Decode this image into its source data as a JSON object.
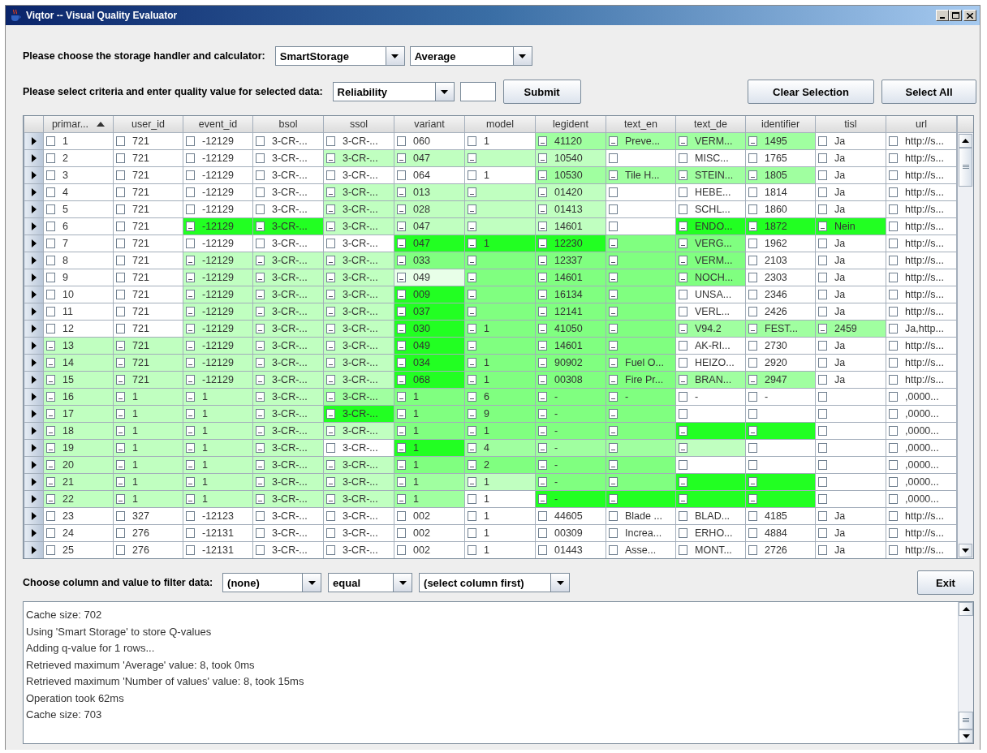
{
  "window": {
    "title": "Viqtor -- Visual Quality Evaluator"
  },
  "storage_row": {
    "label": "Please choose the storage handler and calculator:",
    "handler": "SmartStorage",
    "calculator": "Average"
  },
  "criteria_row": {
    "label": "Please select criteria and enter quality value for selected data:",
    "criteria": "Reliability",
    "submit": "Submit",
    "clear": "Clear Selection",
    "select_all": "Select All"
  },
  "table": {
    "columns": [
      {
        "label": "primar...",
        "sorted": true
      },
      {
        "label": "user_id",
        "sorted": false
      },
      {
        "label": "event_id",
        "sorted": false
      },
      {
        "label": "bsol",
        "sorted": false
      },
      {
        "label": "ssol",
        "sorted": false
      },
      {
        "label": "variant",
        "sorted": false
      },
      {
        "label": "model",
        "sorted": false
      },
      {
        "label": "legident",
        "sorted": false
      },
      {
        "label": "text_en",
        "sorted": false
      },
      {
        "label": "text_de",
        "sorted": false
      },
      {
        "label": "identifier",
        "sorted": false
      },
      {
        "label": "tisl",
        "sorted": false
      },
      {
        "label": "url",
        "sorted": false
      }
    ],
    "rows": [
      {
        "cells": [
          {
            "text": "1",
            "color": "#ffffff"
          },
          {
            "text": "721",
            "color": "#ffffff"
          },
          {
            "text": "-12129",
            "color": "#ffffff"
          },
          {
            "text": "3-CR-...",
            "color": "#ffffff"
          },
          {
            "text": "3-CR-...",
            "color": "#ffffff"
          },
          {
            "text": "060",
            "color": "#ffffff"
          },
          {
            "text": "1",
            "color": "#ffffff"
          },
          {
            "text": "41120",
            "color": "#a0ffa0"
          },
          {
            "text": "Preve...",
            "color": "#a0ffa0"
          },
          {
            "text": "VERM...",
            "color": "#a0ffa0"
          },
          {
            "text": "1495",
            "color": "#a0ffa0"
          },
          {
            "text": "Ja",
            "color": "#ffffff"
          },
          {
            "text": "http://s...",
            "color": "#ffffff"
          }
        ]
      },
      {
        "cells": [
          {
            "text": "2",
            "color": "#ffffff"
          },
          {
            "text": "721",
            "color": "#ffffff"
          },
          {
            "text": "-12129",
            "color": "#ffffff"
          },
          {
            "text": "3-CR-...",
            "color": "#ffffff"
          },
          {
            "text": "3-CR-...",
            "color": "#c0ffc0"
          },
          {
            "text": "047",
            "color": "#c0ffc0"
          },
          {
            "color": "#c0ffc0"
          },
          {
            "text": "10540",
            "color": "#c0ffc0"
          },
          {
            "color": "#ffffff"
          },
          {
            "text": "MISC...",
            "color": "#ffffff"
          },
          {
            "text": "1765",
            "color": "#ffffff"
          },
          {
            "text": "Ja",
            "color": "#ffffff"
          },
          {
            "text": "http://s...",
            "color": "#ffffff"
          }
        ]
      },
      {
        "cells": [
          {
            "text": "3",
            "color": "#ffffff"
          },
          {
            "text": "721",
            "color": "#ffffff"
          },
          {
            "text": "-12129",
            "color": "#ffffff"
          },
          {
            "text": "3-CR-...",
            "color": "#ffffff"
          },
          {
            "text": "3-CR-...",
            "color": "#ffffff"
          },
          {
            "text": "064",
            "color": "#ffffff"
          },
          {
            "text": "1",
            "color": "#ffffff"
          },
          {
            "text": "10530",
            "color": "#a0ffa0"
          },
          {
            "text": "Tile H...",
            "color": "#a0ffa0"
          },
          {
            "text": "STEIN...",
            "color": "#a0ffa0"
          },
          {
            "text": "1805",
            "color": "#a0ffa0"
          },
          {
            "text": "Ja",
            "color": "#ffffff"
          },
          {
            "text": "http://s...",
            "color": "#ffffff"
          }
        ]
      },
      {
        "cells": [
          {
            "text": "4",
            "color": "#ffffff"
          },
          {
            "text": "721",
            "color": "#ffffff"
          },
          {
            "text": "-12129",
            "color": "#ffffff"
          },
          {
            "text": "3-CR-...",
            "color": "#ffffff"
          },
          {
            "text": "3-CR-...",
            "color": "#c0ffc0"
          },
          {
            "text": "013",
            "color": "#c0ffc0"
          },
          {
            "color": "#c0ffc0"
          },
          {
            "text": "01420",
            "color": "#c0ffc0"
          },
          {
            "color": "#ffffff"
          },
          {
            "text": "HEBE...",
            "color": "#ffffff"
          },
          {
            "text": "1814",
            "color": "#ffffff"
          },
          {
            "text": "Ja",
            "color": "#ffffff"
          },
          {
            "text": "http://s...",
            "color": "#ffffff"
          }
        ]
      },
      {
        "cells": [
          {
            "text": "5",
            "color": "#ffffff"
          },
          {
            "text": "721",
            "color": "#ffffff"
          },
          {
            "text": "-12129",
            "color": "#ffffff"
          },
          {
            "text": "3-CR-...",
            "color": "#ffffff"
          },
          {
            "text": "3-CR-...",
            "color": "#c0ffc0"
          },
          {
            "text": "028",
            "color": "#c0ffc0"
          },
          {
            "color": "#c0ffc0"
          },
          {
            "text": "01413",
            "color": "#c0ffc0"
          },
          {
            "color": "#ffffff"
          },
          {
            "text": "SCHL...",
            "color": "#ffffff"
          },
          {
            "text": "1860",
            "color": "#ffffff"
          },
          {
            "text": "Ja",
            "color": "#ffffff"
          },
          {
            "text": "http://s...",
            "color": "#ffffff"
          }
        ]
      },
      {
        "cells": [
          {
            "text": "6",
            "color": "#ffffff"
          },
          {
            "text": "721",
            "color": "#ffffff"
          },
          {
            "text": "-12129",
            "color": "#22ff22"
          },
          {
            "text": "3-CR-...",
            "color": "#22ff22"
          },
          {
            "text": "3-CR-...",
            "color": "#c0ffc0"
          },
          {
            "text": "047",
            "color": "#c0ffc0"
          },
          {
            "color": "#c0ffc0"
          },
          {
            "text": "14601",
            "color": "#c0ffc0"
          },
          {
            "color": "#ffffff"
          },
          {
            "text": "ENDO...",
            "color": "#22ff22"
          },
          {
            "text": "1872",
            "color": "#22ff22"
          },
          {
            "text": "Nein",
            "color": "#22ff22"
          },
          {
            "text": "http://s...",
            "color": "#ffffff"
          }
        ]
      },
      {
        "cells": [
          {
            "text": "7",
            "color": "#ffffff"
          },
          {
            "text": "721",
            "color": "#ffffff"
          },
          {
            "text": "-12129",
            "color": "#ffffff"
          },
          {
            "text": "3-CR-...",
            "color": "#ffffff"
          },
          {
            "text": "3-CR-...",
            "color": "#ffffff"
          },
          {
            "text": "047",
            "color": "#22ff22"
          },
          {
            "text": "1",
            "color": "#22ff22"
          },
          {
            "text": "12230",
            "color": "#22ff22"
          },
          {
            "color": "#80ff80"
          },
          {
            "text": "VERG...",
            "color": "#80ff80"
          },
          {
            "text": "1962",
            "color": "#ffffff"
          },
          {
            "text": "Ja",
            "color": "#ffffff"
          },
          {
            "text": "http://s...",
            "color": "#ffffff"
          }
        ]
      },
      {
        "cells": [
          {
            "text": "8",
            "color": "#ffffff"
          },
          {
            "text": "721",
            "color": "#ffffff"
          },
          {
            "text": "-12129",
            "color": "#c0ffc0"
          },
          {
            "text": "3-CR-...",
            "color": "#c0ffc0"
          },
          {
            "text": "3-CR-...",
            "color": "#c0ffc0"
          },
          {
            "text": "033",
            "color": "#80ff80"
          },
          {
            "color": "#80ff80"
          },
          {
            "text": "12337",
            "color": "#80ff80"
          },
          {
            "color": "#80ff80"
          },
          {
            "text": "VERM...",
            "color": "#80ff80"
          },
          {
            "text": "2103",
            "color": "#ffffff"
          },
          {
            "text": "Ja",
            "color": "#ffffff"
          },
          {
            "text": "http://s...",
            "color": "#ffffff"
          }
        ]
      },
      {
        "cells": [
          {
            "text": "9",
            "color": "#ffffff"
          },
          {
            "text": "721",
            "color": "#ffffff"
          },
          {
            "text": "-12129",
            "color": "#c0ffc0"
          },
          {
            "text": "3-CR-...",
            "color": "#c0ffc0"
          },
          {
            "text": "3-CR-...",
            "color": "#c0ffc0"
          },
          {
            "text": "049",
            "color": "#e8ffe8"
          },
          {
            "color": "#80ff80"
          },
          {
            "text": "14601",
            "color": "#80ff80"
          },
          {
            "color": "#80ff80"
          },
          {
            "text": "NOCH...",
            "color": "#80ff80"
          },
          {
            "text": "2303",
            "color": "#ffffff"
          },
          {
            "text": "Ja",
            "color": "#ffffff"
          },
          {
            "text": "http://s...",
            "color": "#ffffff"
          }
        ]
      },
      {
        "cells": [
          {
            "text": "10",
            "color": "#ffffff"
          },
          {
            "text": "721",
            "color": "#ffffff"
          },
          {
            "text": "-12129",
            "color": "#c0ffc0"
          },
          {
            "text": "3-CR-...",
            "color": "#c0ffc0"
          },
          {
            "text": "3-CR-...",
            "color": "#c0ffc0"
          },
          {
            "text": "009",
            "color": "#22ff22"
          },
          {
            "color": "#80ff80"
          },
          {
            "text": "16134",
            "color": "#80ff80"
          },
          {
            "color": "#80ff80"
          },
          {
            "text": "UNSA...",
            "color": "#ffffff"
          },
          {
            "text": "2346",
            "color": "#ffffff"
          },
          {
            "text": "Ja",
            "color": "#ffffff"
          },
          {
            "text": "http://s...",
            "color": "#ffffff"
          }
        ]
      },
      {
        "cells": [
          {
            "text": "11",
            "color": "#ffffff"
          },
          {
            "text": "721",
            "color": "#ffffff"
          },
          {
            "text": "-12129",
            "color": "#c0ffc0"
          },
          {
            "text": "3-CR-...",
            "color": "#c0ffc0"
          },
          {
            "text": "3-CR-...",
            "color": "#c0ffc0"
          },
          {
            "text": "037",
            "color": "#22ff22"
          },
          {
            "color": "#80ff80"
          },
          {
            "text": "12141",
            "color": "#80ff80"
          },
          {
            "color": "#80ff80"
          },
          {
            "text": "VERL...",
            "color": "#ffffff"
          },
          {
            "text": "2426",
            "color": "#ffffff"
          },
          {
            "text": "Ja",
            "color": "#ffffff"
          },
          {
            "text": "http://s...",
            "color": "#ffffff"
          }
        ]
      },
      {
        "cells": [
          {
            "text": "12",
            "color": "#ffffff"
          },
          {
            "text": "721",
            "color": "#ffffff"
          },
          {
            "text": "-12129",
            "color": "#c0ffc0"
          },
          {
            "text": "3-CR-...",
            "color": "#c0ffc0"
          },
          {
            "text": "3-CR-...",
            "color": "#c0ffc0"
          },
          {
            "text": "030",
            "color": "#22ff22"
          },
          {
            "text": "1",
            "color": "#80ff80"
          },
          {
            "text": "41050",
            "color": "#80ff80"
          },
          {
            "color": "#80ff80"
          },
          {
            "text": "V94.2",
            "color": "#a0ffa0"
          },
          {
            "text": "FEST...",
            "color": "#a0ffa0"
          },
          {
            "text": "2459",
            "color": "#a0ffa0"
          },
          {
            "text": "Ja,http...",
            "color": "#ffffff"
          }
        ]
      },
      {
        "cells": [
          {
            "text": "13",
            "color": "#c0ffc0"
          },
          {
            "text": "721",
            "color": "#c0ffc0"
          },
          {
            "text": "-12129",
            "color": "#c0ffc0"
          },
          {
            "text": "3-CR-...",
            "color": "#c0ffc0"
          },
          {
            "text": "3-CR-...",
            "color": "#c0ffc0"
          },
          {
            "text": "049",
            "color": "#22ff22"
          },
          {
            "color": "#80ff80"
          },
          {
            "text": "14601",
            "color": "#80ff80"
          },
          {
            "color": "#80ff80"
          },
          {
            "text": "AK-RI...",
            "color": "#ffffff"
          },
          {
            "text": "2730",
            "color": "#ffffff"
          },
          {
            "text": "Ja",
            "color": "#ffffff"
          },
          {
            "text": "http://s...",
            "color": "#ffffff"
          }
        ]
      },
      {
        "cells": [
          {
            "text": "14",
            "color": "#c0ffc0"
          },
          {
            "text": "721",
            "color": "#c0ffc0"
          },
          {
            "text": "-12129",
            "color": "#c0ffc0"
          },
          {
            "text": "3-CR-...",
            "color": "#c0ffc0"
          },
          {
            "text": "3-CR-...",
            "color": "#c0ffc0"
          },
          {
            "text": "034",
            "color": "#22ff22"
          },
          {
            "text": "1",
            "color": "#80ff80"
          },
          {
            "text": "90902",
            "color": "#80ff80"
          },
          {
            "text": "Fuel O...",
            "color": "#80ff80"
          },
          {
            "text": "HEIZO...",
            "color": "#ffffff"
          },
          {
            "text": "2920",
            "color": "#ffffff"
          },
          {
            "text": "Ja",
            "color": "#ffffff"
          },
          {
            "text": "http://s...",
            "color": "#ffffff"
          }
        ]
      },
      {
        "cells": [
          {
            "text": "15",
            "color": "#c0ffc0"
          },
          {
            "text": "721",
            "color": "#c0ffc0"
          },
          {
            "text": "-12129",
            "color": "#c0ffc0"
          },
          {
            "text": "3-CR-...",
            "color": "#c0ffc0"
          },
          {
            "text": "3-CR-...",
            "color": "#c0ffc0"
          },
          {
            "text": "068",
            "color": "#22ff22"
          },
          {
            "text": "1",
            "color": "#80ff80"
          },
          {
            "text": "00308",
            "color": "#80ff80"
          },
          {
            "text": "Fire Pr...",
            "color": "#80ff80"
          },
          {
            "text": "BRAN...",
            "color": "#a0ffa0"
          },
          {
            "text": "2947",
            "color": "#a0ffa0"
          },
          {
            "text": "Ja",
            "color": "#ffffff"
          },
          {
            "text": "http://s...",
            "color": "#ffffff"
          }
        ]
      },
      {
        "cells": [
          {
            "text": "16",
            "color": "#c0ffc0"
          },
          {
            "text": "1",
            "color": "#c0ffc0"
          },
          {
            "text": "1",
            "color": "#c0ffc0"
          },
          {
            "text": "3-CR-...",
            "color": "#c0ffc0"
          },
          {
            "text": "3-CR-...",
            "color": "#a0ffa0"
          },
          {
            "text": "1",
            "color": "#80ff80"
          },
          {
            "text": "6",
            "color": "#80ff80"
          },
          {
            "text": "-",
            "color": "#80ff80"
          },
          {
            "text": "-",
            "color": "#80ff80"
          },
          {
            "text": "-",
            "color": "#ffffff"
          },
          {
            "text": "-",
            "color": "#ffffff"
          },
          {
            "color": "#ffffff"
          },
          {
            "text": ",0000...",
            "color": "#ffffff"
          }
        ]
      },
      {
        "cells": [
          {
            "text": "17",
            "color": "#c0ffc0"
          },
          {
            "text": "1",
            "color": "#c0ffc0"
          },
          {
            "text": "1",
            "color": "#c0ffc0"
          },
          {
            "text": "3-CR-...",
            "color": "#c0ffc0"
          },
          {
            "text": "3-CR-...",
            "color": "#22ff22"
          },
          {
            "text": "1",
            "color": "#80ff80"
          },
          {
            "text": "9",
            "color": "#80ff80"
          },
          {
            "text": "-",
            "color": "#80ff80"
          },
          {
            "color": "#80ff80"
          },
          {
            "color": "#ffffff"
          },
          {
            "color": "#ffffff"
          },
          {
            "color": "#ffffff"
          },
          {
            "text": ",0000...",
            "color": "#ffffff"
          }
        ]
      },
      {
        "cells": [
          {
            "text": "18",
            "color": "#c0ffc0"
          },
          {
            "text": "1",
            "color": "#c0ffc0"
          },
          {
            "text": "1",
            "color": "#c0ffc0"
          },
          {
            "text": "3-CR-...",
            "color": "#c0ffc0"
          },
          {
            "text": "3-CR-...",
            "color": "#c0ffc0"
          },
          {
            "text": "1",
            "color": "#80ff80"
          },
          {
            "text": "1",
            "color": "#80ff80"
          },
          {
            "text": "-",
            "color": "#80ff80"
          },
          {
            "color": "#80ff80"
          },
          {
            "color": "#22ff22"
          },
          {
            "color": "#22ff22"
          },
          {
            "color": "#ffffff"
          },
          {
            "text": ",0000...",
            "color": "#ffffff"
          }
        ]
      },
      {
        "cells": [
          {
            "text": "19",
            "color": "#c0ffc0"
          },
          {
            "text": "1",
            "color": "#c0ffc0"
          },
          {
            "text": "1",
            "color": "#c0ffc0"
          },
          {
            "text": "3-CR-...",
            "color": "#c0ffc0"
          },
          {
            "text": "3-CR-...",
            "color": "#ffffff"
          },
          {
            "text": "1",
            "color": "#22ff22"
          },
          {
            "text": "4",
            "color": "#a0ffa0"
          },
          {
            "text": "-",
            "color": "#a0ffa0"
          },
          {
            "color": "#a0ffa0"
          },
          {
            "color": "#c0ffc0"
          },
          {
            "color": "#ffffff"
          },
          {
            "color": "#ffffff"
          },
          {
            "text": ",0000...",
            "color": "#ffffff"
          }
        ]
      },
      {
        "cells": [
          {
            "text": "20",
            "color": "#c0ffc0"
          },
          {
            "text": "1",
            "color": "#c0ffc0"
          },
          {
            "text": "1",
            "color": "#c0ffc0"
          },
          {
            "text": "3-CR-...",
            "color": "#c0ffc0"
          },
          {
            "text": "3-CR-...",
            "color": "#c0ffc0"
          },
          {
            "text": "1",
            "color": "#80ff80"
          },
          {
            "text": "2",
            "color": "#80ff80"
          },
          {
            "text": "-",
            "color": "#80ff80"
          },
          {
            "color": "#80ff80"
          },
          {
            "color": "#ffffff"
          },
          {
            "color": "#ffffff"
          },
          {
            "color": "#ffffff"
          },
          {
            "text": ",0000...",
            "color": "#ffffff"
          }
        ]
      },
      {
        "cells": [
          {
            "text": "21",
            "color": "#c0ffc0"
          },
          {
            "text": "1",
            "color": "#c0ffc0"
          },
          {
            "text": "1",
            "color": "#c0ffc0"
          },
          {
            "text": "3-CR-...",
            "color": "#c0ffc0"
          },
          {
            "text": "3-CR-...",
            "color": "#c0ffc0"
          },
          {
            "text": "1",
            "color": "#a0ffa0"
          },
          {
            "text": "1",
            "color": "#c0ffc0"
          },
          {
            "text": "-",
            "color": "#80ff80"
          },
          {
            "color": "#80ff80"
          },
          {
            "color": "#22ff22"
          },
          {
            "color": "#22ff22"
          },
          {
            "color": "#ffffff"
          },
          {
            "text": ",0000...",
            "color": "#ffffff"
          }
        ]
      },
      {
        "cells": [
          {
            "text": "22",
            "color": "#c0ffc0"
          },
          {
            "text": "1",
            "color": "#c0ffc0"
          },
          {
            "text": "1",
            "color": "#c0ffc0"
          },
          {
            "text": "3-CR-...",
            "color": "#c0ffc0"
          },
          {
            "text": "3-CR-...",
            "color": "#c0ffc0"
          },
          {
            "text": "1",
            "color": "#a0ffa0"
          },
          {
            "text": "1",
            "color": "#ffffff"
          },
          {
            "text": "-",
            "color": "#22ff22"
          },
          {
            "color": "#22ff22"
          },
          {
            "color": "#22ff22"
          },
          {
            "color": "#22ff22"
          },
          {
            "color": "#ffffff"
          },
          {
            "text": ",0000...",
            "color": "#ffffff"
          }
        ]
      },
      {
        "cells": [
          {
            "text": "23",
            "color": "#ffffff"
          },
          {
            "text": "327",
            "color": "#ffffff"
          },
          {
            "text": "-12123",
            "color": "#ffffff"
          },
          {
            "text": "3-CR-...",
            "color": "#ffffff"
          },
          {
            "text": "3-CR-...",
            "color": "#ffffff"
          },
          {
            "text": "002",
            "color": "#ffffff"
          },
          {
            "text": "1",
            "color": "#ffffff"
          },
          {
            "text": "44605",
            "color": "#ffffff"
          },
          {
            "text": "Blade ...",
            "color": "#ffffff"
          },
          {
            "text": "BLAD...",
            "color": "#ffffff"
          },
          {
            "text": "4185",
            "color": "#ffffff"
          },
          {
            "text": "Ja",
            "color": "#ffffff"
          },
          {
            "text": "http://s...",
            "color": "#ffffff"
          }
        ]
      },
      {
        "cells": [
          {
            "text": "24",
            "color": "#ffffff"
          },
          {
            "text": "276",
            "color": "#ffffff"
          },
          {
            "text": "-12131",
            "color": "#ffffff"
          },
          {
            "text": "3-CR-...",
            "color": "#ffffff"
          },
          {
            "text": "3-CR-...",
            "color": "#ffffff"
          },
          {
            "text": "002",
            "color": "#ffffff"
          },
          {
            "text": "1",
            "color": "#ffffff"
          },
          {
            "text": "00309",
            "color": "#ffffff"
          },
          {
            "text": "Increa...",
            "color": "#ffffff"
          },
          {
            "text": "ERHO...",
            "color": "#ffffff"
          },
          {
            "text": "4884",
            "color": "#ffffff"
          },
          {
            "text": "Ja",
            "color": "#ffffff"
          },
          {
            "text": "http://s...",
            "color": "#ffffff"
          }
        ]
      },
      {
        "cells": [
          {
            "text": "25",
            "color": "#ffffff"
          },
          {
            "text": "276",
            "color": "#ffffff"
          },
          {
            "text": "-12131",
            "color": "#ffffff"
          },
          {
            "text": "3-CR-...",
            "color": "#ffffff"
          },
          {
            "text": "3-CR-...",
            "color": "#ffffff"
          },
          {
            "text": "002",
            "color": "#ffffff"
          },
          {
            "text": "1",
            "color": "#ffffff"
          },
          {
            "text": "01443",
            "color": "#ffffff"
          },
          {
            "text": "Asse...",
            "color": "#ffffff"
          },
          {
            "text": "MONT...",
            "color": "#ffffff"
          },
          {
            "text": "2726",
            "color": "#ffffff"
          },
          {
            "text": "Ja",
            "color": "#ffffff"
          },
          {
            "text": "http://s...",
            "color": "#ffffff"
          }
        ]
      }
    ]
  },
  "filter_row": {
    "label": "Choose column and value to filter data:",
    "column": "(none)",
    "operator": "equal",
    "value": "(select column first)",
    "exit": "Exit"
  },
  "log": {
    "lines": [
      "Cache size: 702",
      "Using 'Smart Storage' to store Q-values",
      "Adding q-value for 1 rows...",
      "Retrieved maximum 'Average' value: 8, took 0ms",
      "Retrieved maximum 'Number of values' value: 8, took 15ms",
      "Operation took 62ms",
      "Cache size: 703"
    ]
  }
}
